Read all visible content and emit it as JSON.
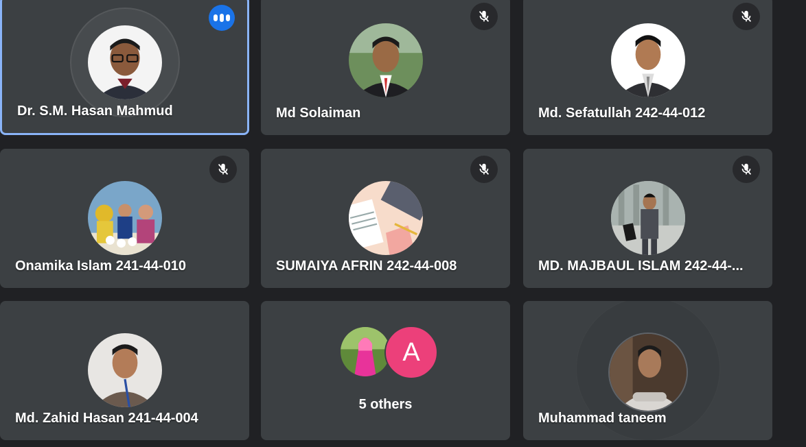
{
  "participants": [
    {
      "name": "Dr. S.M. Hasan Mahmud",
      "status": "speaking",
      "avatar_icon": "profile-photo"
    },
    {
      "name": "Md Solaiman",
      "status": "muted",
      "avatar_icon": "profile-photo"
    },
    {
      "name": "Md. Sefatullah 242-44-012",
      "status": "muted",
      "avatar_icon": "profile-photo"
    },
    {
      "name": "Onamika Islam 241-44-010",
      "status": "muted",
      "avatar_icon": "profile-photo"
    },
    {
      "name": "SUMAIYA AFRIN 242-44-008",
      "status": "muted",
      "avatar_icon": "illustration-photo"
    },
    {
      "name": "MD. MAJBAUL ISLAM 242-44-...",
      "status": "muted",
      "avatar_icon": "profile-photo"
    },
    {
      "name": "Md. Zahid Hasan 241-44-004",
      "status": "none",
      "avatar_icon": "profile-photo"
    },
    {
      "name": "Muhammad taneem",
      "status": "none",
      "avatar_icon": "profile-photo"
    }
  ],
  "others": {
    "letter": "A",
    "label": "5 others",
    "letter_color": "#ec407a"
  },
  "colors": {
    "background": "#202124",
    "tile": "#3c4043",
    "active_border": "#8ab4f8",
    "speaking_badge": "#1a73e8"
  }
}
